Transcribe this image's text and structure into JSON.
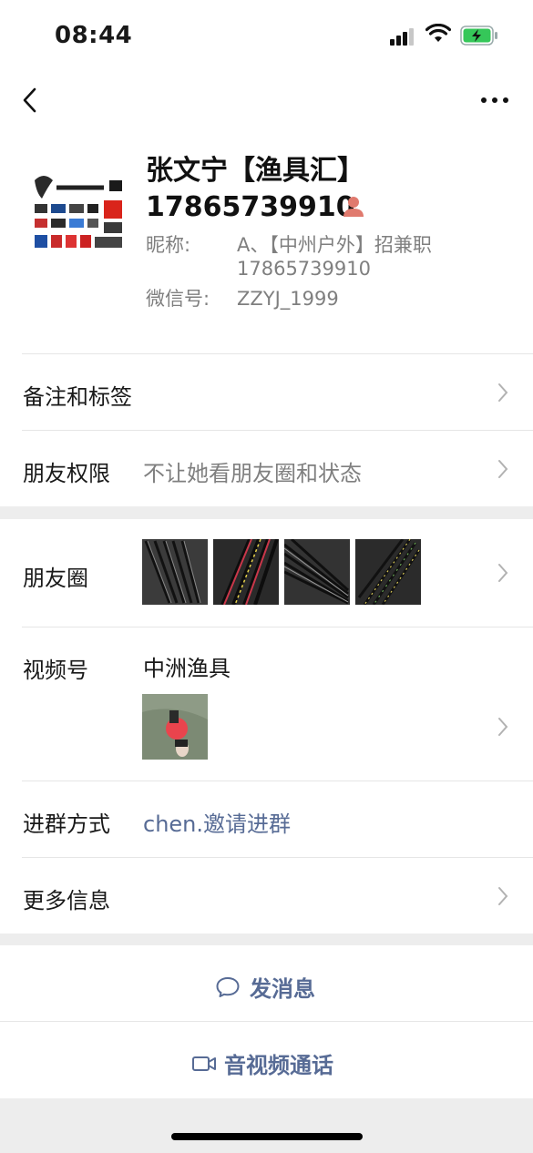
{
  "status": {
    "time": "08:44"
  },
  "profile": {
    "name": "张文宁【渔具汇】",
    "phone": "17865739910",
    "nickname_label": "昵称:",
    "nickname_line1": "A、【中州户外】招兼职",
    "nickname_line2": "17865739910",
    "wechat_label": "微信号:",
    "wechat_id": "ZZYJ_1999"
  },
  "rows": {
    "remark_label": "备注和标签",
    "permission_label": "朋友权限",
    "permission_value": "不让她看朋友圈和状态",
    "moments_label": "朋友圈",
    "channels_label": "视频号",
    "channels_value": "中洲渔具",
    "join_label": "进群方式",
    "join_value": "chen.邀请进群",
    "more_label": "更多信息"
  },
  "actions": {
    "message_label": "发消息",
    "call_label": "音视频通话"
  },
  "icons": [
    "back-icon",
    "more-icon",
    "person-icon",
    "chevron-right-icon",
    "message-icon",
    "video-call-icon"
  ],
  "colors": {
    "link": "#576b95",
    "gray_text": "#7f7f7f",
    "background": "#ededed"
  }
}
